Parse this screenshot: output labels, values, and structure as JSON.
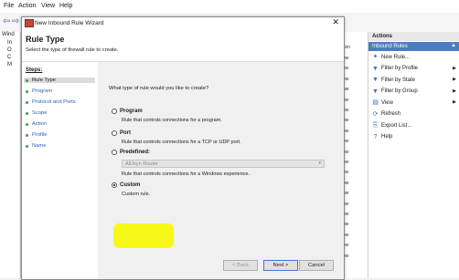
{
  "menu": [
    "File",
    "Action",
    "View",
    "Help"
  ],
  "tree": [
    {
      "label": "Wind"
    },
    {
      "label": "In"
    },
    {
      "label": "O"
    },
    {
      "label": "C"
    },
    {
      "label": "M"
    }
  ],
  "wizard": {
    "title": "New Inbound Rule Wizard",
    "close": "✕",
    "heading": "Rule Type",
    "subtitle": "Select the type of firewall rule to create.",
    "steps_label": "Steps:",
    "steps": [
      "Rule Type",
      "Program",
      "Protocol and Ports",
      "Scope",
      "Action",
      "Profile",
      "Name"
    ],
    "question": "What type of rule would you like to create?",
    "options": [
      {
        "label": "Program",
        "desc": "Rule that controls connections for a program."
      },
      {
        "label": "Port",
        "desc": "Rule that controls connections for a TCP or UDP port."
      },
      {
        "label": "Predefined:",
        "desc": "Rule that controls connections for a Windows experience."
      },
      {
        "label": "Custom",
        "desc": "Custom rule."
      }
    ],
    "predefined_value": "AllJoyn Router",
    "selected": "Custom",
    "buttons": {
      "back": "< Back",
      "next": "Next >",
      "cancel": "Cancel"
    }
  },
  "middle": {
    "header": "tion",
    "rows": [
      "ow",
      "ow",
      "ow",
      "ow",
      "ow",
      "ow",
      "ow",
      "ow",
      "ow",
      "ow",
      "ow",
      "ow",
      "ow",
      "ow",
      "ow",
      "ow",
      "ow",
      "ow",
      "ow",
      "ow"
    ]
  },
  "actions": {
    "title": "Actions",
    "section": "Inbound Rules",
    "items": [
      {
        "label": "New Rule...",
        "icon": "new-rule-icon",
        "arrow": false
      },
      {
        "label": "Filter by Profile",
        "icon": "filter-icon",
        "arrow": true
      },
      {
        "label": "Filter by State",
        "icon": "filter-icon",
        "arrow": true
      },
      {
        "label": "Filter by Group",
        "icon": "filter-icon",
        "arrow": true
      },
      {
        "label": "View",
        "icon": "view-icon",
        "arrow": true
      },
      {
        "label": "Refresh",
        "icon": "refresh-icon",
        "arrow": false
      },
      {
        "label": "Export List...",
        "icon": "export-icon",
        "arrow": false
      },
      {
        "label": "Help",
        "icon": "help-icon",
        "arrow": false
      }
    ]
  },
  "colors": {
    "highlight": "#f8f800",
    "accent": "#4a7dc3",
    "step_dot": "#3aa13a"
  }
}
